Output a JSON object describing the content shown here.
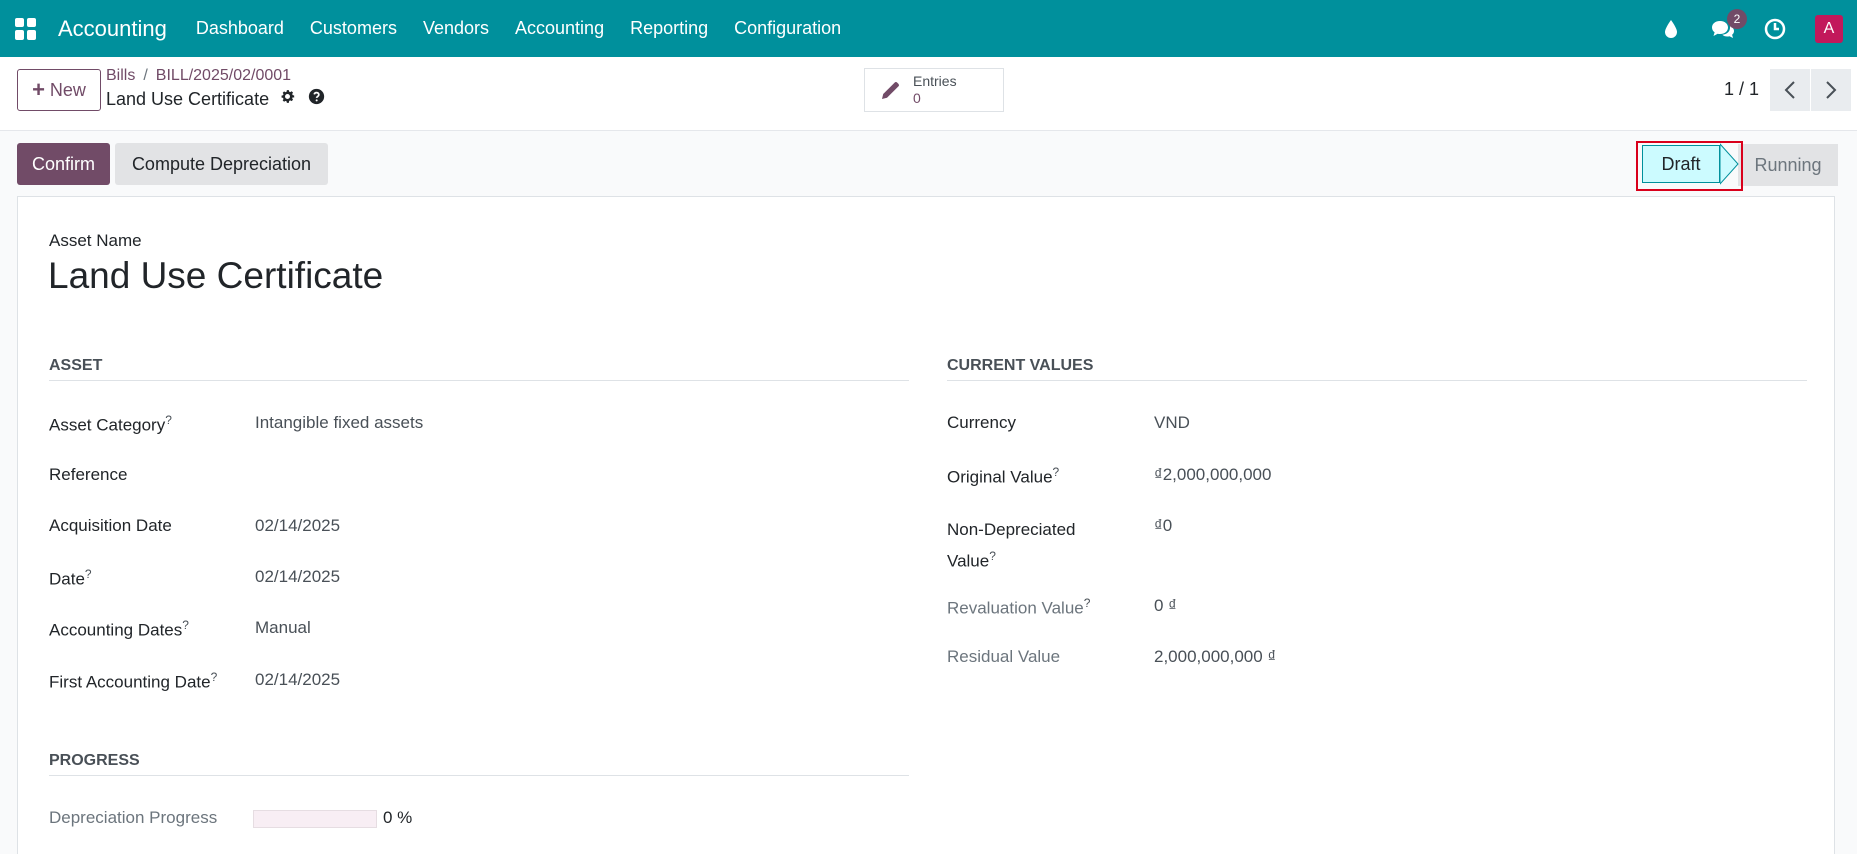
{
  "navbar": {
    "app_name": "Accounting",
    "menu": [
      "Dashboard",
      "Customers",
      "Vendors",
      "Accounting",
      "Reporting",
      "Configuration"
    ],
    "icons": [
      "apps-icon",
      "droplet-icon",
      "chat-icon",
      "clock-icon"
    ],
    "message_count": "2",
    "avatar_letter": "A"
  },
  "control_panel": {
    "new_label": "New",
    "breadcrumb": [
      "Bills",
      "BILL/2025/02/0001"
    ],
    "record_title": "Land Use Certificate",
    "entries_label": "Entries",
    "entries_count": "0",
    "pager": "1 / 1"
  },
  "actions": {
    "confirm_label": "Confirm",
    "compute_label": "Compute Depreciation"
  },
  "status": {
    "stages": [
      "Draft",
      "Running"
    ],
    "current": "Draft"
  },
  "form": {
    "name_label": "Asset Name",
    "name_value": "Land Use Certificate",
    "asset_section": {
      "title": "ASSET",
      "fields": [
        {
          "label": "Asset Category",
          "help": "?",
          "value": "Intangible fixed assets"
        },
        {
          "label": "Reference",
          "help": "",
          "value": ""
        },
        {
          "label": "Acquisition Date",
          "help": "",
          "value": "02/14/2025"
        },
        {
          "label": "Date",
          "help": "?",
          "value": "02/14/2025"
        },
        {
          "label": "Accounting Dates",
          "help": "?",
          "value": "Manual"
        },
        {
          "label": "First Accounting Date",
          "help": "?",
          "value": "02/14/2025"
        }
      ]
    },
    "values_section": {
      "title": "CURRENT VALUES",
      "fields": [
        {
          "label": "Currency",
          "help": "",
          "value": "VND"
        },
        {
          "label": "Original Value",
          "help": "?",
          "value": "₫2,000,000,000"
        },
        {
          "label": "Non-Depreciated",
          "label2": "Value",
          "help": "?",
          "value": "₫0"
        },
        {
          "label": "Revaluation Value",
          "help": "?",
          "value": "0 ₫"
        },
        {
          "label": "Residual Value",
          "help": "",
          "value": "2,000,000,000 ₫"
        }
      ]
    },
    "progress_section": {
      "title": "PROGRESS",
      "label": "Depreciation Progress",
      "value": "0 %",
      "fraction": 0
    }
  },
  "colors": {
    "navbar": "#00909c",
    "primary": "#714b67",
    "highlight": "#d9001b",
    "stage_active": "#ccfbff"
  }
}
